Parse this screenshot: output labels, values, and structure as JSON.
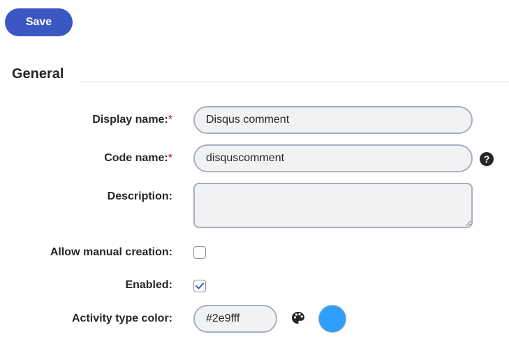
{
  "toolbar": {
    "save_label": "Save"
  },
  "section": {
    "title": "General"
  },
  "fields": {
    "display_name": {
      "label": "Display name:",
      "required_marker": "*",
      "value": "Disqus comment"
    },
    "code_name": {
      "label": "Code name:",
      "required_marker": "*",
      "value": "disquscomment",
      "help_icon": "question-circle-icon",
      "help_glyph": "?"
    },
    "description": {
      "label": "Description:",
      "value": ""
    },
    "allow_manual_creation": {
      "label": "Allow manual creation:",
      "checked": false
    },
    "enabled": {
      "label": "Enabled:",
      "checked": true
    },
    "activity_type_color": {
      "label": "Activity type color:",
      "value": "#2e9fff",
      "picker_icon": "palette-icon",
      "swatch_color": "#2e9fff"
    }
  },
  "colors": {
    "primary": "#3b57c4",
    "required": "#d0021b",
    "input_bg": "#f1f2f4",
    "input_border": "#a9aebb",
    "checkmark": "#3b57c4"
  }
}
